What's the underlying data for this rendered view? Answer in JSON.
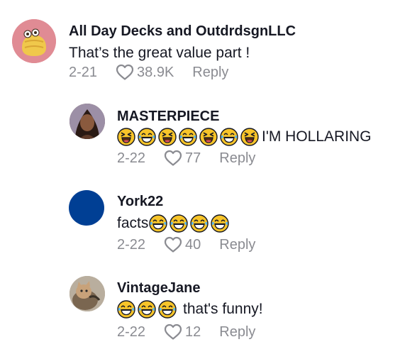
{
  "comments": [
    {
      "username": "All Day Decks and OutdrdsgnLLC",
      "text": "That’s the great value part !",
      "date": "2-21",
      "likes": "38.9K",
      "reply_label": "Reply",
      "avatar_icon": "pastry-avatar"
    },
    {
      "username": "MASTERPIECE",
      "text_suffix": "I'M HOLLARING",
      "emojis": [
        "squint-laugh",
        "tears-of-joy",
        "squint-laugh",
        "tears-of-joy",
        "squint-laugh",
        "tears-of-joy",
        "squint-laugh"
      ],
      "date": "2-22",
      "likes": "77",
      "reply_label": "Reply"
    },
    {
      "username": "York22",
      "text_prefix": "facts",
      "emojis": [
        "tears-of-joy",
        "tears-of-joy",
        "tears-of-joy",
        "tears-of-joy"
      ],
      "date": "2-22",
      "likes": "40",
      "reply_label": "Reply",
      "avatar_color": "#003f94"
    },
    {
      "username": "VintageJane",
      "emojis": [
        "tears-of-joy",
        "tears-of-joy",
        "tears-of-joy"
      ],
      "text_suffix": "that's funny!",
      "date": "2-22",
      "likes": "12",
      "reply_label": "Reply"
    }
  ],
  "colors": {
    "meta": "#8a8b91",
    "text": "#161823",
    "emoji": "#f7c429"
  }
}
